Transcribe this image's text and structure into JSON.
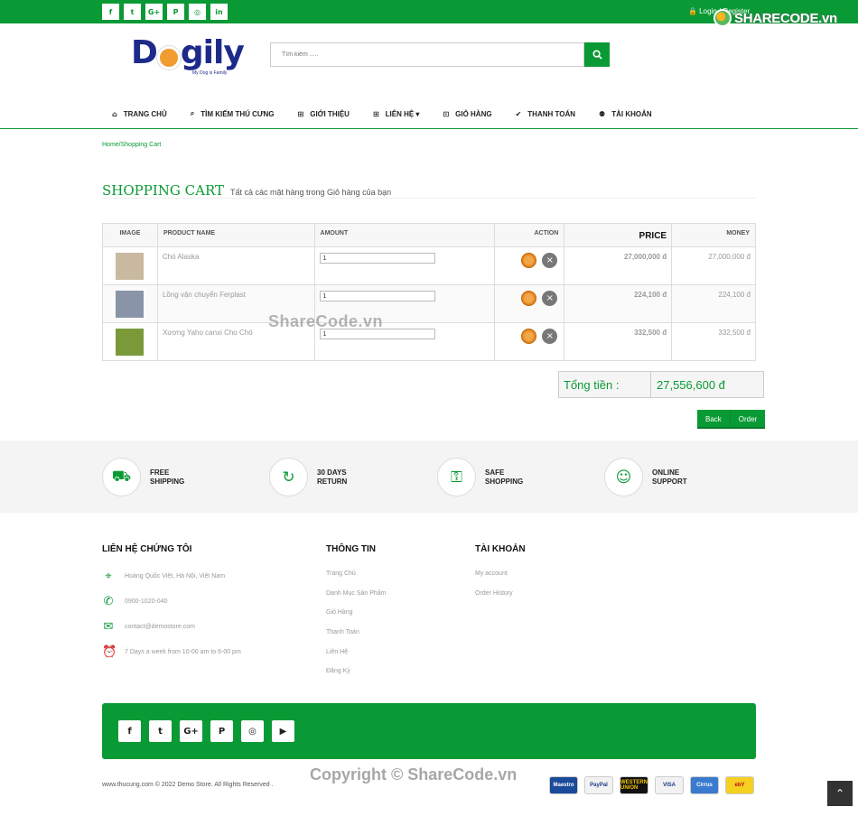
{
  "topbar": {
    "social": [
      {
        "icon": "facebook-icon",
        "glyph": "f"
      },
      {
        "icon": "twitter-icon",
        "glyph": "t"
      },
      {
        "icon": "google-plus-icon",
        "glyph": "G+"
      },
      {
        "icon": "pinterest-icon",
        "glyph": "P"
      },
      {
        "icon": "instagram-icon",
        "glyph": "◎"
      },
      {
        "icon": "linkedin-icon",
        "glyph": "in"
      }
    ],
    "login": "🔒 Login / Register"
  },
  "watermark": {
    "logo_text": "SHARECODE.vn",
    "mid": "ShareCode.vn",
    "bottom": "Copyright © ShareCode.vn"
  },
  "brand": {
    "name": "D",
    "name_tail": "gily",
    "tagline": "My Dog is Family"
  },
  "search": {
    "placeholder": "Tìm kiếm ....."
  },
  "nav": [
    {
      "label": "TRANG CHỦ",
      "icon": "home-icon",
      "glyph": "⌂"
    },
    {
      "label": "TÌM KIẾM THÚ CƯNG",
      "icon": "search-icon",
      "glyph": "⌕"
    },
    {
      "label": "GIỚI THIỆU",
      "icon": "sitemap-icon",
      "glyph": "⊞"
    },
    {
      "label": "LIÊN HỆ ▾",
      "icon": "sitemap-icon",
      "glyph": "⊞"
    },
    {
      "label": "GIỎ HÀNG",
      "icon": "cart-icon",
      "glyph": "⊡"
    },
    {
      "label": "THANH TOÁN",
      "icon": "check-circle-icon",
      "glyph": "✔"
    },
    {
      "label": "TÀI KHOẢN",
      "icon": "user-group-icon",
      "glyph": "⚉"
    }
  ],
  "breadcrumb": "Home/Shopping Cart",
  "page": {
    "title": "SHOPPING CART",
    "subtitle": "Tất cả các mặt hàng trong Giỏ hàng của bạn"
  },
  "cart": {
    "headers": {
      "image": "IMAGE",
      "product": "PRODUCT NAME",
      "amount": "AMOUNT",
      "action": "ACTION",
      "price": "PRICE",
      "money": "MONEY"
    },
    "rows": [
      {
        "name": "Chó Alaska",
        "qty": "1",
        "price": "27,000,000 đ",
        "money": "27,000,000 đ",
        "thumb_color": "#c9b9a0"
      },
      {
        "name": "Lồng vận chuyển Ferplast",
        "qty": "1",
        "price": "224,100 đ",
        "money": "224,100 đ",
        "thumb_color": "#8a94a8"
      },
      {
        "name": "Xương Yaho canxi Cho Chó",
        "qty": "1",
        "price": "332,500 đ",
        "money": "332,500 đ",
        "thumb_color": "#7a9a3a"
      }
    ],
    "total_label": "Tổng tiền :",
    "total_value": "27,556,600 đ",
    "back_label": "Back",
    "order_label": "Order"
  },
  "features": [
    {
      "label": "FREE SHIPPING",
      "icon": "car-icon",
      "glyph": "⛟"
    },
    {
      "label": "30 DAYS RETURN",
      "icon": "return-icon",
      "glyph": "↻"
    },
    {
      "label": "SAFE SHOPPING",
      "icon": "lock-icon",
      "glyph": "⚿"
    },
    {
      "label": "ONLINE SUPPORT",
      "icon": "support-icon",
      "glyph": "☺"
    }
  ],
  "footer": {
    "contact": {
      "title": "LIÊN HỆ CHỨNG TÔI",
      "items": [
        {
          "icon": "location-icon",
          "glyph": "⌖",
          "text": "Hoàng Quốc Việt, Hà Nội, Việt Nam"
        },
        {
          "icon": "phone-icon",
          "glyph": "✆",
          "text": "0900-1020-040"
        },
        {
          "icon": "mail-icon",
          "glyph": "✉",
          "text": "contact@demostore.com"
        },
        {
          "icon": "clock-icon",
          "glyph": "⏰",
          "text": "7 Days a week from 10-00 am to 6-00 pm"
        }
      ]
    },
    "info": {
      "title": "THÔNG TIN",
      "links": [
        "Trang Chủ",
        "Danh Mục Sản Phẩm",
        "Giỏ Hàng",
        "Thanh Toán",
        "Liên Hệ",
        "Đăng Ký"
      ]
    },
    "account": {
      "title": "TÀI KHOẢN",
      "links": [
        "My account",
        "Order History"
      ]
    },
    "social": [
      {
        "icon": "facebook-icon",
        "glyph": "f"
      },
      {
        "icon": "twitter-icon",
        "glyph": "t"
      },
      {
        "icon": "google-plus-icon",
        "glyph": "G+"
      },
      {
        "icon": "pinterest-icon",
        "glyph": "P"
      },
      {
        "icon": "instagram-icon",
        "glyph": "◎"
      },
      {
        "icon": "youtube-icon",
        "glyph": "▶"
      }
    ],
    "copyright": "www.thucung.com © 2022 Demo Store. All Rights Reserved .",
    "payments": [
      {
        "label": "Maestro",
        "bg": "#1a4a9a",
        "fg": "#fff"
      },
      {
        "label": "PayPal",
        "bg": "#f2f2f2",
        "fg": "#1a3a8a"
      },
      {
        "label": "WESTERN UNION",
        "bg": "#111",
        "fg": "#f2c200"
      },
      {
        "label": "VISA",
        "bg": "#f2f2f2",
        "fg": "#1a3a8a"
      },
      {
        "label": "Cirrus",
        "bg": "#3a7ad0",
        "fg": "#fff"
      },
      {
        "label": "ebY",
        "bg": "#f5d020",
        "fg": "#c0001a"
      }
    ]
  },
  "colors": {
    "accent": "#0a9a35"
  }
}
